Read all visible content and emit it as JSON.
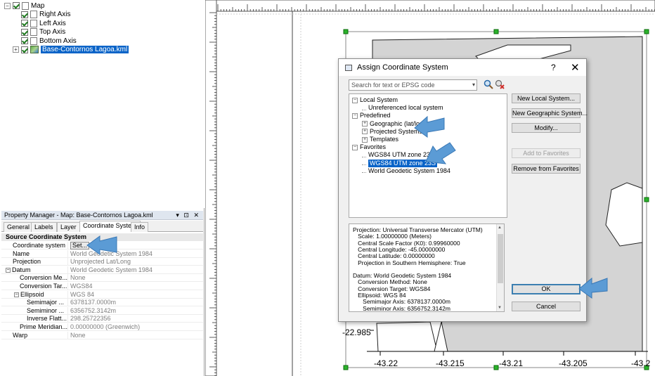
{
  "layer_tree": {
    "items": [
      {
        "label": "Map",
        "indent": 0,
        "expander": "⊟",
        "checked": true,
        "icon": "page-icon",
        "selected": false
      },
      {
        "label": "Right Axis",
        "indent": 1,
        "expander": "",
        "checked": true,
        "icon": "page-icon",
        "selected": false
      },
      {
        "label": "Left Axis",
        "indent": 1,
        "expander": "",
        "checked": true,
        "icon": "page-icon",
        "selected": false
      },
      {
        "label": "Top Axis",
        "indent": 1,
        "expander": "",
        "checked": true,
        "icon": "page-icon",
        "selected": false
      },
      {
        "label": "Bottom Axis",
        "indent": 1,
        "expander": "",
        "checked": true,
        "icon": "page-icon",
        "selected": false
      },
      {
        "label": "Base-Contornos Lagoa.kml",
        "indent": 1,
        "expander": "⊞",
        "checked": true,
        "icon": "layer-icon",
        "selected": true
      }
    ]
  },
  "property_manager": {
    "title": "Property Manager - Map: Base-Contornos Lagoa.kml",
    "title_controls": "▾ ⊡ ✕",
    "tabs": [
      "General",
      "Labels",
      "Layer",
      "Coordinate System",
      "Info"
    ],
    "active_tab": "Coordinate System",
    "section": "Source Coordinate System",
    "rows": [
      {
        "key": "Coordinate system",
        "value": "Set...",
        "indent": 0,
        "expander": "",
        "is_button": true
      },
      {
        "key": "Name",
        "value": "World Geodetic System 1984",
        "indent": 0,
        "expander": ""
      },
      {
        "key": "Projection",
        "value": "Unprojected Lat/Long",
        "indent": 0,
        "expander": ""
      },
      {
        "key": "Datum",
        "value": "World Geodetic System 1984",
        "indent": 0,
        "expander": "−"
      },
      {
        "key": "Conversion Me...",
        "value": "None",
        "indent": 1,
        "expander": ""
      },
      {
        "key": "Conversion Tar...",
        "value": "WGS84",
        "indent": 1,
        "expander": ""
      },
      {
        "key": "Ellipsoid",
        "value": "WGS 84",
        "indent": 1,
        "expander": "−"
      },
      {
        "key": "Semimajor ...",
        "value": "6378137.0000m",
        "indent": 2,
        "expander": ""
      },
      {
        "key": "Semiminor ...",
        "value": "6356752.3142m",
        "indent": 2,
        "expander": ""
      },
      {
        "key": "Inverse Flatt...",
        "value": "298.25722356",
        "indent": 2,
        "expander": ""
      },
      {
        "key": "Prime Meridian...",
        "value": "0.00000000 (Greenwich)",
        "indent": 1,
        "expander": ""
      },
      {
        "key": "Warp",
        "value": "None",
        "indent": 0,
        "expander": ""
      }
    ]
  },
  "map": {
    "y_axis_label": "-22.985",
    "x_axis_labels": [
      "-43.22",
      "-43.215",
      "-43.21",
      "-43.205",
      "-43.2"
    ],
    "fill_color": "#d4d4d4"
  },
  "dialog": {
    "title": "Assign Coordinate System",
    "help": "?",
    "close": "✕",
    "search_placeholder": "Search for text or EPSG code",
    "search_icon": "magnifier-icon",
    "clear_icon": "clear-search-icon",
    "tree": [
      {
        "label": "Local System",
        "indent": 0,
        "expander": "⊟",
        "selected": false
      },
      {
        "label": "Unreferenced local system",
        "indent": 1,
        "expander": "",
        "selected": false
      },
      {
        "label": "Predefined",
        "indent": 0,
        "expander": "⊟",
        "selected": false
      },
      {
        "label": "Geographic (lat/lon)",
        "indent": 1,
        "expander": "⊞",
        "selected": false
      },
      {
        "label": "Projected Systems",
        "indent": 1,
        "expander": "⊞",
        "selected": false
      },
      {
        "label": "Templates",
        "indent": 1,
        "expander": "⊞",
        "selected": false
      },
      {
        "label": "Favorites",
        "indent": 0,
        "expander": "⊟",
        "selected": false
      },
      {
        "label": "WGS84 UTM zone 23S",
        "indent": 1,
        "expander": "",
        "selected": false
      },
      {
        "label": "WGS84 UTM zone 23S",
        "indent": 1,
        "expander": "",
        "selected": true
      },
      {
        "label": "World Geodetic System 1984",
        "indent": 1,
        "expander": "",
        "selected": false
      }
    ],
    "info_lines": [
      "Projection: Universal Transverse Mercator (UTM)",
      "   Scale: 1.00000000 (Meters)",
      "   Central Scale Factor (K0): 0.99960000",
      "   Central Longitude: -45.00000000",
      "   Central Latitude: 0.00000000",
      "   Projection in Southern Hemisphere: True",
      "",
      "Datum: World Geodetic System 1984",
      "   Conversion Method: None",
      "   Conversion Target: WGS84",
      "   Ellipsoid: WGS 84",
      "      Semimajor Axis: 6378137.0000m",
      "      Semiminor Axis: 6356752.3142m"
    ],
    "buttons": {
      "new_local": "New Local System...",
      "new_geographic": "New Geographic System...",
      "modify": "Modify...",
      "add_favorites": "Add to Favorites",
      "remove_favorites": "Remove from Favorites",
      "ok": "OK",
      "cancel": "Cancel"
    }
  },
  "colors": {
    "selection": "#0a64c8",
    "callout_arrow": "#5b9bd5"
  }
}
